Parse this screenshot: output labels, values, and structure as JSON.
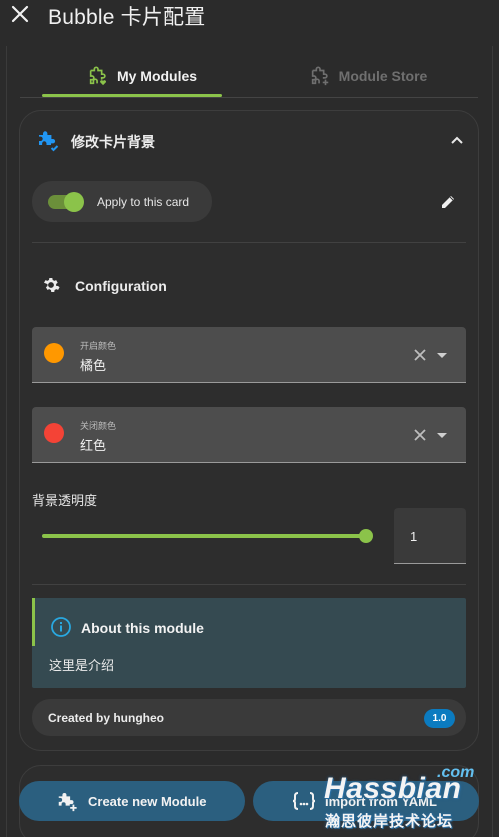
{
  "header": {
    "title": "Bubble 卡片配置"
  },
  "tabs": [
    {
      "label": "My Modules",
      "active": true
    },
    {
      "label": "Module Store",
      "active": false
    }
  ],
  "module": {
    "title": "修改卡片背景",
    "apply_label": "Apply to this card",
    "apply_enabled": true,
    "config_heading": "Configuration",
    "fields": [
      {
        "label": "开启颜色",
        "value": "橘色",
        "color": "#ff9800"
      },
      {
        "label": "关闭颜色",
        "value": "红色",
        "color": "#f44336"
      }
    ],
    "opacity": {
      "label": "背景透明度",
      "value": "1",
      "level": 1.0
    },
    "about": {
      "title": "About this module",
      "body": "这里是介绍"
    },
    "author": "Created by hungheo",
    "version": "1.0"
  },
  "actions": {
    "create_label": "Create new Module",
    "import_label": "Import from YAML"
  },
  "watermark": {
    "suffix": ".com",
    "brand": "Hassbian",
    "tagline": "瀚思彼岸技术论坛"
  },
  "colors": {
    "accent_green": "#8bc34a",
    "puzzle_blue": "#2196f3",
    "info_blue": "#29a8e0",
    "version_badge": "#0b7bc0",
    "button_bg": "#2b5f7f",
    "about_bg": "#354a51"
  },
  "icons": {
    "close": "close-icon",
    "my_modules": "puzzle-heart-icon",
    "store": "puzzle-plus-icon",
    "module": "puzzle-check-icon",
    "collapse": "chevron-up-icon",
    "edit": "pencil-icon",
    "config": "gear-icon",
    "info": "info-icon",
    "create": "puzzle-plus-icon",
    "import": "code-braces-icon"
  }
}
